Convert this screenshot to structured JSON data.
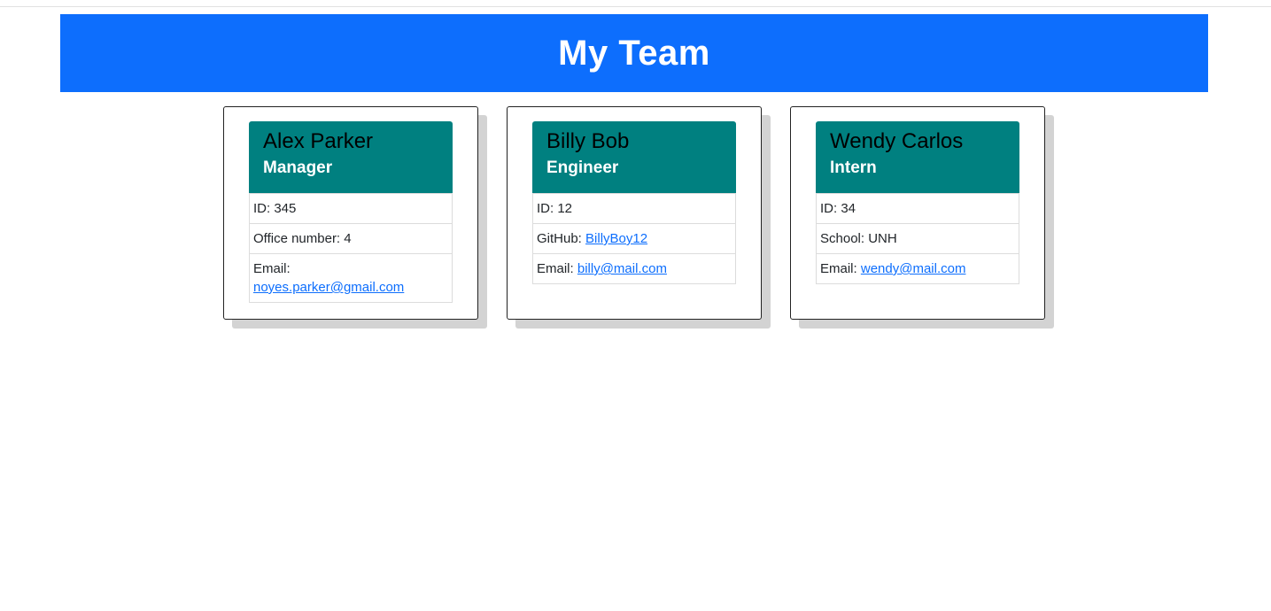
{
  "page": {
    "title": "My Team"
  },
  "colors": {
    "header_bg": "#0d6efd",
    "card_head_bg": "#008080",
    "link": "#0d6efd"
  },
  "team": [
    {
      "name": "Alex Parker",
      "role": "Manager",
      "id_label": "ID: 345",
      "extra_label": "Office number: 4",
      "email_prefix": "Email:",
      "email": "noyes.parker@gmail.com"
    },
    {
      "name": "Billy Bob",
      "role": "Engineer",
      "id_label": "ID: 12",
      "extra_prefix": "GitHub:",
      "extra_link": "BillyBoy12",
      "email_prefix": "Email:",
      "email": "billy@mail.com"
    },
    {
      "name": "Wendy Carlos",
      "role": "Intern",
      "id_label": "ID: 34",
      "extra_label": "School: UNH",
      "email_prefix": "Email:",
      "email": "wendy@mail.com"
    }
  ]
}
